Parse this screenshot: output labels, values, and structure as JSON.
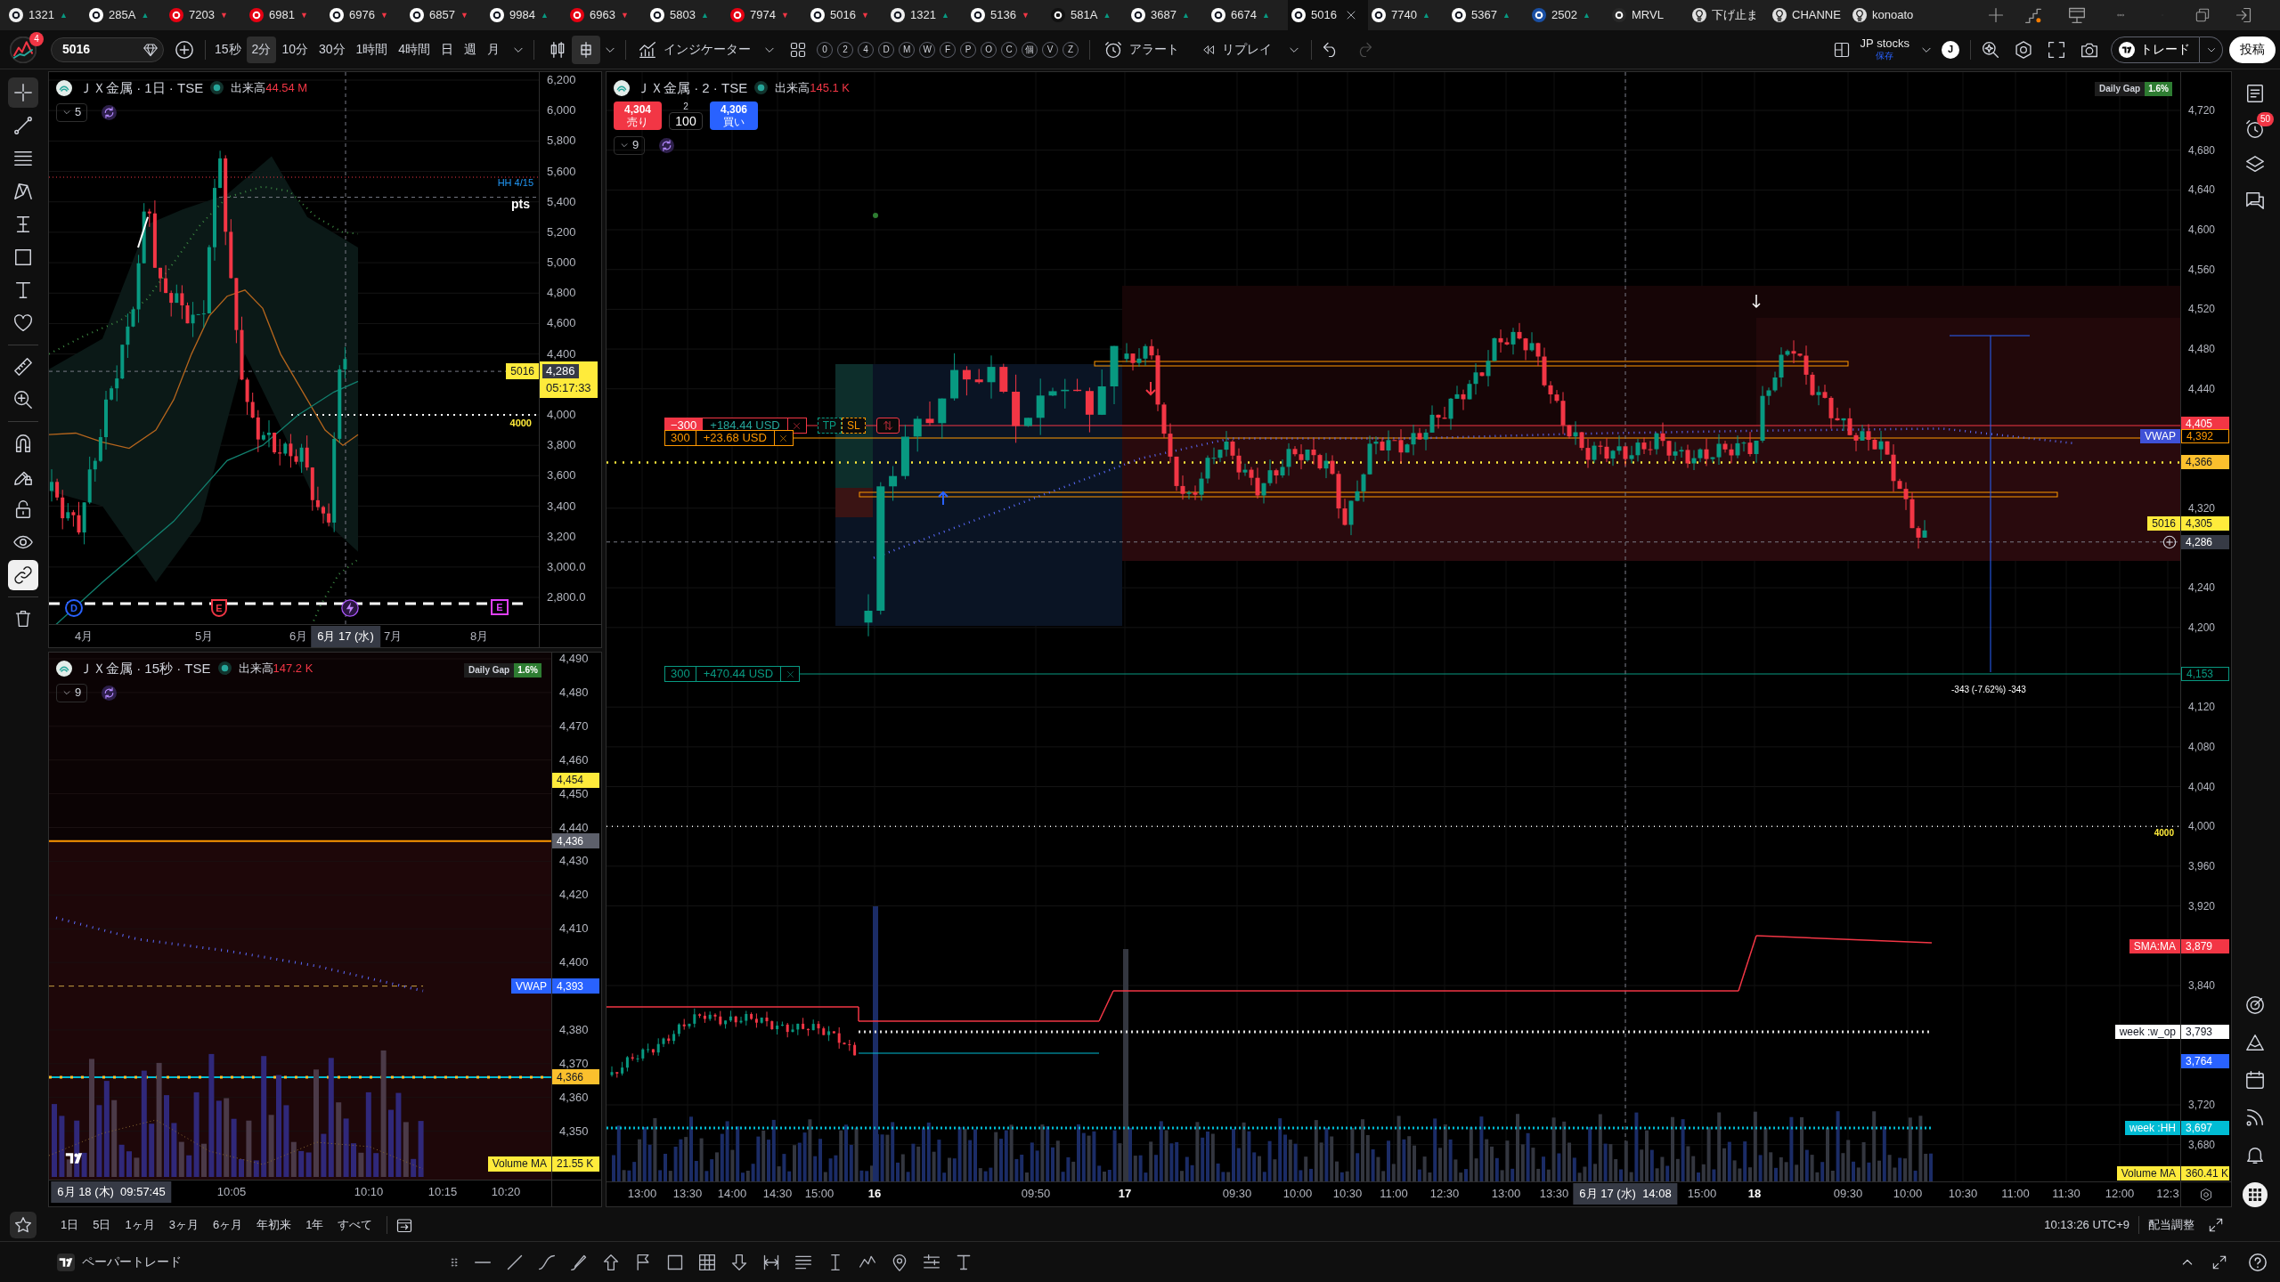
{
  "tabs": [
    {
      "kind": "symbol",
      "label": "1321",
      "arrow": {
        "glyph": "▲",
        "color": "#089981"
      },
      "color": "#f0f0f0",
      "selected": false
    },
    {
      "kind": "symbol",
      "label": "285A",
      "arrow": {
        "glyph": "▲",
        "color": "#089981"
      },
      "color": "#ffffff",
      "selected": false
    },
    {
      "kind": "symbol",
      "label": "7203",
      "arrow": {
        "glyph": "▼",
        "color": "#f23645"
      },
      "color": "#e60012",
      "selected": false
    },
    {
      "kind": "symbol",
      "label": "6981",
      "arrow": {
        "glyph": "▼",
        "color": "#f23645"
      },
      "color": "#e60012",
      "selected": false
    },
    {
      "kind": "symbol",
      "label": "6976",
      "arrow": {
        "glyph": "▼",
        "color": "#f23645"
      },
      "color": "#ffffff",
      "selected": false
    },
    {
      "kind": "symbol",
      "label": "6857",
      "arrow": {
        "glyph": "▼",
        "color": "#f23645"
      },
      "color": "#ffffff",
      "selected": false
    },
    {
      "kind": "symbol",
      "label": "9984",
      "arrow": {
        "glyph": "▲",
        "color": "#089981"
      },
      "color": "#ffffff",
      "selected": false
    },
    {
      "kind": "symbol",
      "label": "6963",
      "arrow": {
        "glyph": "▼",
        "color": "#f23645"
      },
      "color": "#e60012",
      "selected": false
    },
    {
      "kind": "symbol",
      "label": "5803",
      "arrow": {
        "glyph": "▲",
        "color": "#089981"
      },
      "color": "#ffffff",
      "selected": false
    },
    {
      "kind": "symbol",
      "label": "7974",
      "arrow": {
        "glyph": "▼",
        "color": "#f23645"
      },
      "color": "#e60012",
      "selected": false
    },
    {
      "kind": "symbol",
      "label": "5016",
      "arrow": {
        "glyph": "▼",
        "color": "#f23645"
      },
      "color": "#ffffff",
      "selected": false
    },
    {
      "kind": "symbol",
      "label": "1321",
      "arrow": {
        "glyph": "▲",
        "color": "#089981"
      },
      "color": "#f0f0f0",
      "selected": false
    },
    {
      "kind": "symbol",
      "label": "5136",
      "arrow": {
        "glyph": "▼",
        "color": "#f23645"
      },
      "color": "#ffffff",
      "selected": false
    },
    {
      "kind": "symbol",
      "label": "581A",
      "arrow": {
        "glyph": "▲",
        "color": "#089981"
      },
      "color": "#111111",
      "selected": false
    },
    {
      "kind": "symbol",
      "label": "3687",
      "arrow": {
        "glyph": "▲",
        "color": "#089981"
      },
      "color": "#ffffff",
      "selected": false
    },
    {
      "kind": "symbol",
      "label": "6674",
      "arrow": {
        "glyph": "▲",
        "color": "#089981"
      },
      "color": "#ffffff",
      "selected": false
    },
    {
      "kind": "symbol",
      "label": "5016",
      "color": "#ffffff",
      "selected": true
    },
    {
      "kind": "symbol",
      "label": "7740",
      "arrow": {
        "glyph": "▲",
        "color": "#089981"
      },
      "color": "#ffffff",
      "selected": false
    },
    {
      "kind": "symbol",
      "label": "5367",
      "arrow": {
        "glyph": "▲",
        "color": "#089981"
      },
      "color": "#ffffff",
      "selected": false
    },
    {
      "kind": "symbol",
      "label": "2502",
      "arrow": {
        "glyph": "▲",
        "color": "#089981"
      },
      "color": "#1a4fa3",
      "selected": false
    },
    {
      "kind": "symbol",
      "label": "MRVL",
      "color": "#2a2a2a",
      "selected": false
    },
    {
      "kind": "idea",
      "label": "下げ止ま",
      "color": "#e0e0e0",
      "selected": false
    },
    {
      "kind": "idea",
      "label": "CHANNE",
      "color": "#e0e0e0",
      "selected": false
    },
    {
      "kind": "idea",
      "label": "konoato",
      "color": "#e0e0e0",
      "selected": false
    }
  ],
  "toolbar": {
    "notification_count": "4",
    "symbol": "5016",
    "intervals": [
      {
        "label": "15秒",
        "selected": false
      },
      {
        "label": "2分",
        "selected": true
      },
      {
        "label": "10分",
        "selected": false
      },
      {
        "label": "30分",
        "selected": false
      },
      {
        "label": "1時間",
        "selected": false
      },
      {
        "label": "4時間",
        "selected": false
      },
      {
        "label": "日",
        "selected": false
      },
      {
        "label": "週",
        "selected": false
      },
      {
        "label": "月",
        "selected": false
      }
    ],
    "chart_styles": [
      {
        "kind": "candles",
        "selected": false
      },
      {
        "kind": "hollow",
        "selected": true
      }
    ],
    "indicators": "インジケーター",
    "quick_keys": [
      "0",
      "2",
      "4",
      "D",
      "M",
      "W",
      "F",
      "P",
      "O",
      "C",
      "個",
      "V",
      "Z"
    ],
    "alert": "アラート",
    "replay": "リプレイ",
    "redo_disabled": true,
    "layout_name": "JP stocks",
    "layout_status": "保存",
    "user_initial": "J",
    "trade": "トレード",
    "publish": "投稿"
  },
  "drawing_tools": [
    {
      "kind": "crosshair",
      "selected": true
    },
    {
      "kind": "trend-line",
      "selected": false
    },
    {
      "kind": "fib",
      "selected": false
    },
    {
      "kind": "pattern",
      "selected": false
    },
    {
      "kind": "projection",
      "selected": false
    },
    {
      "kind": "rectangle",
      "selected": false
    },
    {
      "kind": "text",
      "selected": false
    },
    {
      "kind": "heart",
      "selected": false
    },
    {
      "kind": "ruler",
      "selected": false
    },
    {
      "kind": "zoom-in",
      "selected": false
    }
  ],
  "toggles": [
    {
      "kind": "magnet",
      "on": false
    },
    {
      "kind": "draw-lock",
      "on": false
    },
    {
      "kind": "lock",
      "on": false
    },
    {
      "kind": "eye",
      "on": false
    },
    {
      "kind": "link",
      "on": true
    }
  ],
  "charts": {
    "daily": {
      "title": "ＪＸ金属 · 1日 · TSE",
      "volume_label": "出来高",
      "volume_value": "44.54 M",
      "indicator_count": "5",
      "price_ticks": [
        "6,200",
        "6,000",
        "5,800",
        "5,600",
        "5,400",
        "5,200",
        "5,000",
        "4,800",
        "4,600",
        "4,400",
        "4,000",
        "3,800",
        "3,600",
        "3,400",
        "3,200",
        "3,000.0",
        "2,800.0"
      ],
      "time_ticks": [
        {
          "label": "4月",
          "kind": "tick"
        },
        {
          "label": "5月",
          "kind": "tick"
        },
        {
          "label": "6月",
          "kind": "tick"
        },
        {
          "label": "6月 17 (水)",
          "kind": "crosshair"
        },
        {
          "label": "7月",
          "kind": "tick"
        },
        {
          "label": "8月",
          "kind": "tick"
        }
      ],
      "price_labels": [
        {
          "kind": "countdown",
          "tag": {
            "label": "5016",
            "color": "#ffeb3b"
          },
          "value": "4,286",
          "timer": "05:17:33",
          "color": "#ffeb3b"
        }
      ],
      "annotations": [
        {
          "kind": "pivot",
          "text": "HH 4/15"
        },
        {
          "kind": "unit",
          "text": "pts"
        },
        {
          "kind": "level",
          "text": "4000"
        }
      ],
      "events": [
        {
          "kind": "dividend",
          "label": "D"
        },
        {
          "kind": "earnings",
          "label": "E"
        },
        {
          "kind": "flash"
        },
        {
          "kind": "estimate",
          "label": "E"
        }
      ]
    },
    "ticks": {
      "title": "ＪＸ金属 · 15秒 · TSE",
      "volume_label": "出来高",
      "volume_value": "147.2 K",
      "indicator_count": "9",
      "daily_gap": {
        "label": "Daily Gap",
        "value": "1.6%"
      },
      "price_ticks": [
        "4,490",
        "4,480",
        "4,470",
        "4,460",
        "4,450",
        "4,440",
        "4,430",
        "4,420",
        "4,410",
        "4,400",
        "4,380",
        "4,370",
        "4,360",
        "4,350"
      ],
      "time_ticks": [
        {
          "label": "6月 18 (木)  09:57:45",
          "kind": "crosshair"
        },
        {
          "label": "10:05",
          "kind": "tick"
        },
        {
          "label": "10:10",
          "kind": "tick"
        },
        {
          "label": "10:15",
          "kind": "tick"
        },
        {
          "label": "10:20",
          "kind": "tick"
        }
      ],
      "price_labels": [
        {
          "kind": "solid",
          "value": "4,454",
          "color": "#ffeb3b"
        },
        {
          "kind": "solid",
          "value": "4,436",
          "color": "#5d606b"
        },
        {
          "kind": "solid",
          "tag": {
            "label": "VWAP",
            "color": "#2962ff"
          },
          "value": "4,393",
          "color": "#2962ff"
        },
        {
          "kind": "solid",
          "value": "4,366",
          "color": "#fbc02d"
        },
        {
          "kind": "volume",
          "tag": {
            "label": "Volume MA",
            "color": "#ffeb3b"
          },
          "value": "21.55 K",
          "color": "#ffeb3b"
        }
      ]
    },
    "main": {
      "title": "ＪＸ金属 · 2 · TSE",
      "volume_label": "出来高",
      "volume_value": "145.1 K",
      "order_panel": {
        "sell_price": "4,304",
        "sell_label": "売り",
        "spread": "2",
        "quantity": "100",
        "buy_price": "4,306",
        "buy_label": "買い"
      },
      "indicator_count": "9",
      "daily_gap": {
        "label": "Daily Gap",
        "value": "1.6%"
      },
      "positions": [
        {
          "quantity": "−300",
          "pnl": "+184.44 USD",
          "color": "#f23645",
          "filled": true,
          "brackets": [
            "TP",
            "SL"
          ]
        },
        {
          "quantity": "300",
          "pnl": "+23.68 USD",
          "color": "#ff9800",
          "filled": false
        },
        {
          "quantity": "300",
          "pnl": "+470.44 USD",
          "color": "#089981",
          "filled": false
        }
      ],
      "annotations": [
        {
          "kind": "measure",
          "text": "-343 (-7.62%) -343"
        },
        {
          "kind": "level",
          "text": "4000"
        }
      ],
      "price_ticks": [
        "4,720",
        "4,680",
        "4,640",
        "4,600",
        "4,560",
        "4,520",
        "4,480",
        "4,440",
        "4,320",
        "4,240",
        "4,200",
        "4,120",
        "4,080",
        "4,040",
        "4,000",
        "3,960",
        "3,920",
        "3,840",
        "3,720",
        "3,680"
      ],
      "time_ticks": [
        {
          "label": "13:00",
          "kind": "tick"
        },
        {
          "label": "13:30",
          "kind": "tick"
        },
        {
          "label": "14:00",
          "kind": "tick"
        },
        {
          "label": "14:30",
          "kind": "tick"
        },
        {
          "label": "15:00",
          "kind": "tick"
        },
        {
          "label": "16",
          "kind": "day"
        },
        {
          "label": "09:50",
          "kind": "tick"
        },
        {
          "label": "17",
          "kind": "day"
        },
        {
          "label": "09:30",
          "kind": "tick"
        },
        {
          "label": "10:00",
          "kind": "tick"
        },
        {
          "label": "10:30",
          "kind": "tick"
        },
        {
          "label": "11:00",
          "kind": "tick"
        },
        {
          "label": "12:30",
          "kind": "tick"
        },
        {
          "label": "13:00",
          "kind": "tick"
        },
        {
          "label": "13:30",
          "kind": "tick"
        },
        {
          "label": "6月 17 (水)  14:08",
          "kind": "crosshair"
        },
        {
          "label": "15:00",
          "kind": "tick"
        },
        {
          "label": "18",
          "kind": "day"
        },
        {
          "label": "09:30",
          "kind": "tick"
        },
        {
          "label": "10:00",
          "kind": "tick"
        },
        {
          "label": "10:30",
          "kind": "tick"
        },
        {
          "label": "11:00",
          "kind": "tick"
        },
        {
          "label": "11:30",
          "kind": "tick"
        },
        {
          "label": "12:00",
          "kind": "tick"
        },
        {
          "label": "12:3",
          "kind": "tick"
        }
      ],
      "price_labels": [
        {
          "kind": "solid",
          "value": "4,405",
          "color": "#f23645"
        },
        {
          "kind": "outline",
          "tag": {
            "label": "VWAP",
            "color": "#3f51d6"
          },
          "value": "4,392",
          "color": "#ff9800"
        },
        {
          "kind": "solid",
          "value": "4,366",
          "color": "#fbc02d"
        },
        {
          "kind": "solid",
          "tag": {
            "label": "5016",
            "color": "#ffeb3b"
          },
          "value": "4,305",
          "color": "#ffeb3b"
        },
        {
          "kind": "crosshair",
          "value": "4,286",
          "color": "#363a45"
        },
        {
          "kind": "outline",
          "value": "4,153",
          "color": "#089981"
        },
        {
          "kind": "solid",
          "tag": {
            "label": "SMA:MA",
            "color": "#f23645"
          },
          "value": "3,879",
          "color": "#f23645"
        },
        {
          "kind": "solid",
          "tag": {
            "label": "week :w_op",
            "color": "#ffffff"
          },
          "value": "3,793",
          "color": "#ffffff"
        },
        {
          "kind": "solid",
          "value": "3,764",
          "color": "#2962ff"
        },
        {
          "kind": "solid",
          "tag": {
            "label": "week :HH",
            "color": "#00bcd4"
          },
          "value": "3,697",
          "color": "#00bcd4"
        },
        {
          "kind": "volume",
          "tag": {
            "label": "Volume MA",
            "color": "#ffeb3b"
          },
          "value": "360.41 K",
          "color": "#ffeb3b"
        }
      ]
    }
  },
  "range_bar": {
    "ranges": [
      "1日",
      "5日",
      "1ヶ月",
      "3ヶ月",
      "6ヶ月",
      "年初来",
      "1年",
      "すべて"
    ],
    "clock": "10:13:26 UTC+9",
    "adjustment": "配当調整"
  },
  "bottom_bar": {
    "mode": "ペーパートレード"
  },
  "right_sidebar": {
    "alert_count": "50"
  }
}
